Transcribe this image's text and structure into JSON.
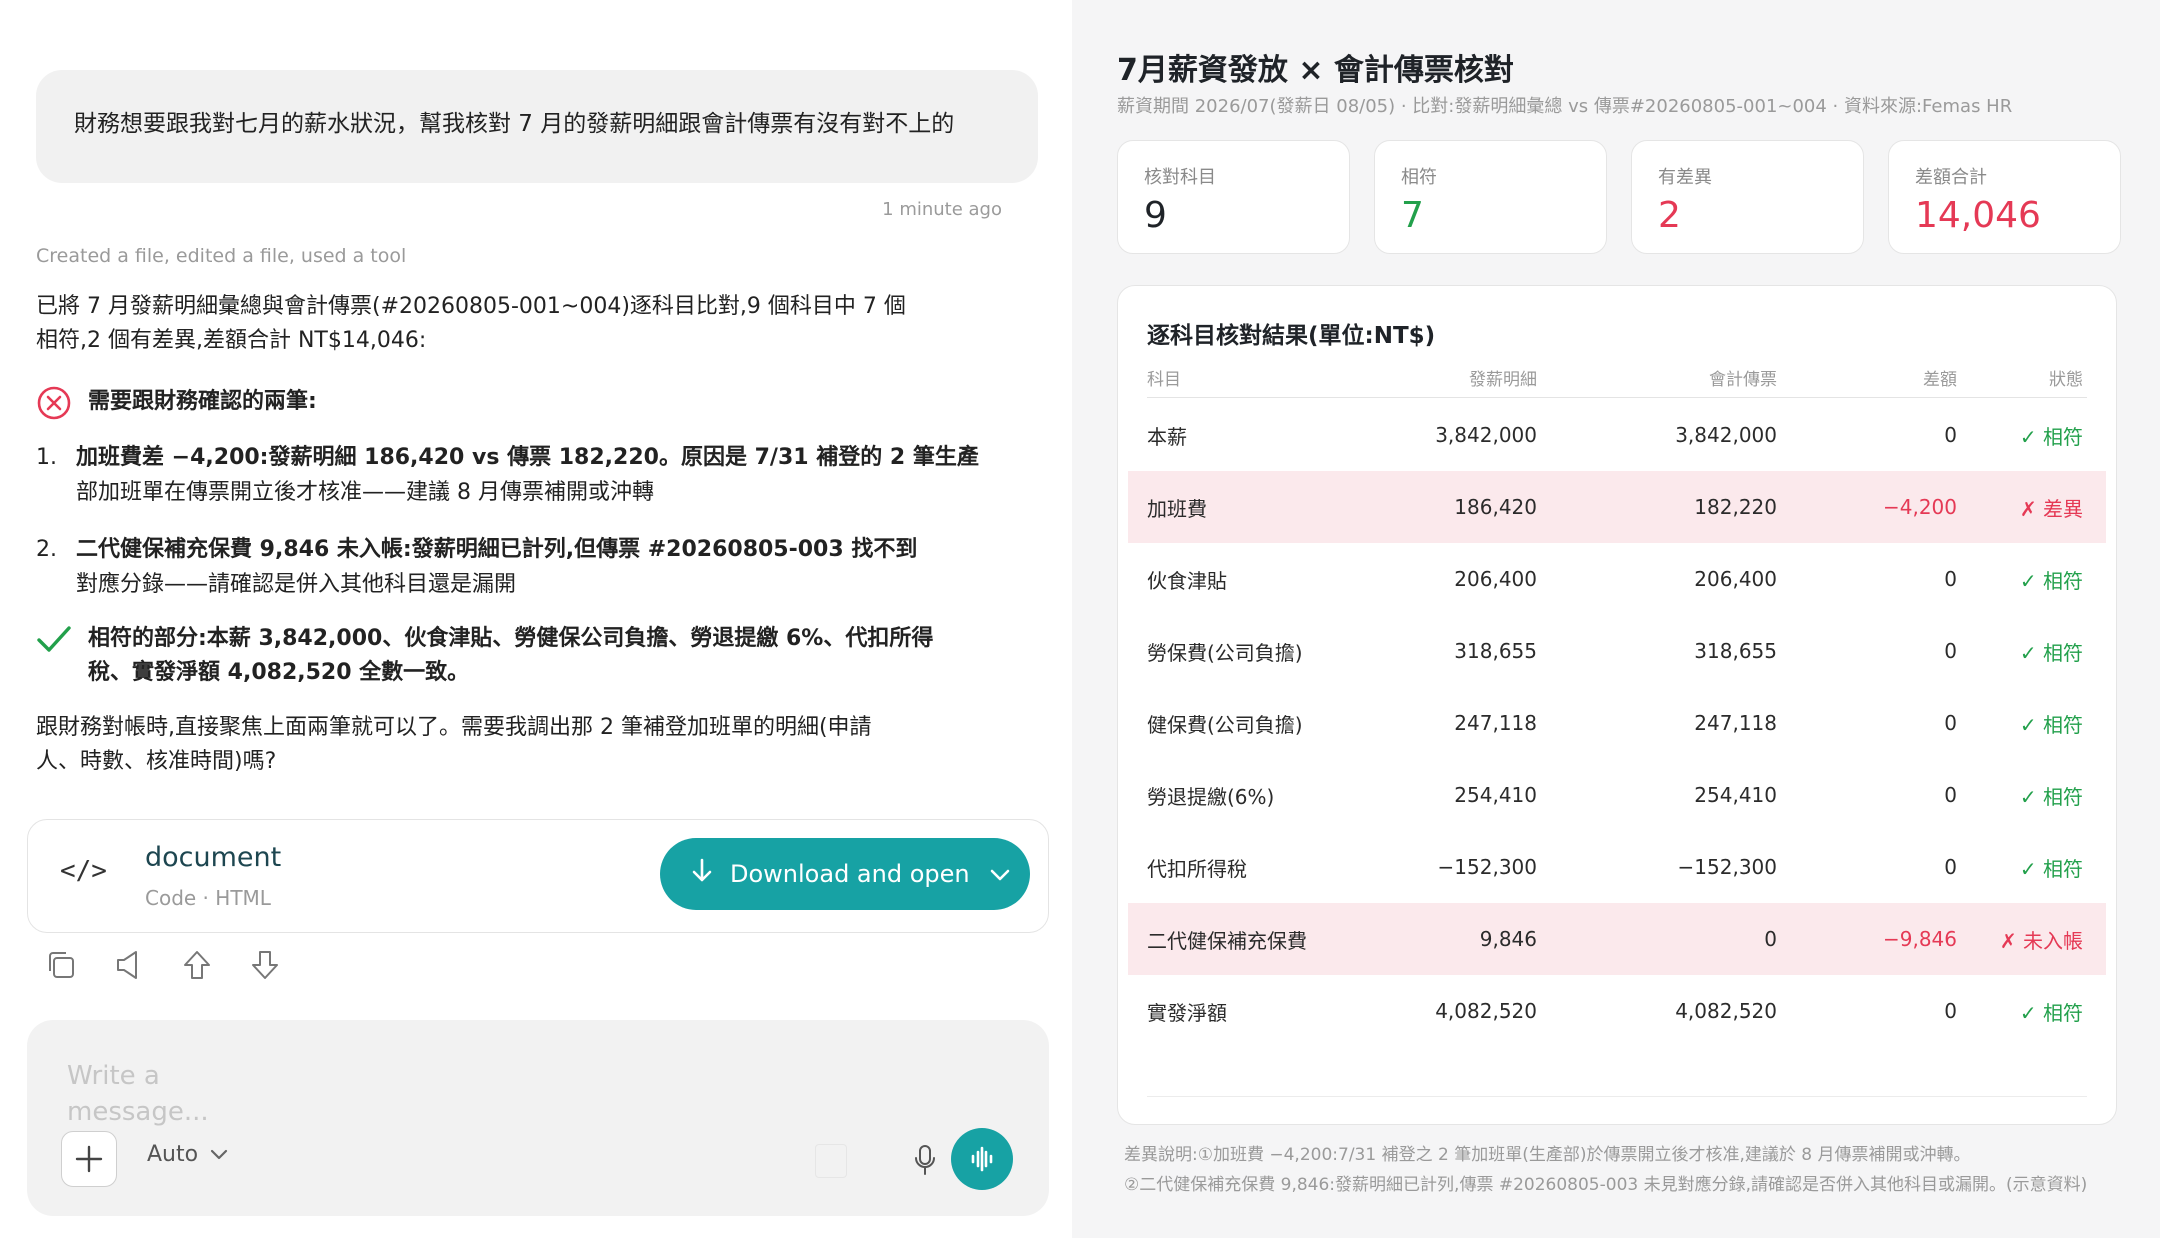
{
  "chat": {
    "user_message": "財務想要跟我對七月的薪水狀況，幫我核對 7 月的發薪明細跟會計傳票有沒有對不上的",
    "timestamp": "1 minute ago",
    "tool_note": "Created a file, edited a file, used a tool",
    "intro_line1": "已將 7 月發薪明細彙總與會計傳票(#20260805-001~004)逐科目比對,9 個科目中 7 個",
    "intro_line2": "相符,2 個有差異,差額合計 NT$14,046:",
    "section_diff_title": "需要跟財務確認的兩筆:",
    "items": [
      {
        "num": "1.",
        "bold": "加班費差 −4,200:發薪明細 186,420 vs 傳票 182,220。原因是 7/31 補登的 2 筆生產",
        "line2": "部加班單在傳票開立後才核准——建議 8 月傳票補開或沖轉"
      },
      {
        "num": "2.",
        "bold": "二代健保補充保費 9,846 未入帳:發薪明細已計列,但傳票 #20260805-003 找不到",
        "line2": "對應分錄——請確認是併入其他科目還是漏開"
      }
    ],
    "section_ok_line1": "相符的部分:本薪 3,842,000、伙食津貼、勞健保公司負擔、勞退提繳 6%、代扣所得",
    "section_ok_line2": "稅、實發淨額 4,082,520 全數一致。",
    "closing_line1": "跟財務對帳時,直接聚焦上面兩筆就可以了。需要我調出那 2 筆補登加班單的明細(申請",
    "closing_line2": "人、時數、核准時間)嗎?",
    "file": {
      "name": "document",
      "meta": "Code · HTML",
      "code_glyph": "</>",
      "download_label": "Download and open"
    },
    "composer": {
      "placeholder": "Write a message...",
      "model": "Auto"
    },
    "icons": [
      "copy-icon",
      "speaker-icon",
      "thumb-up-icon",
      "thumb-down-icon",
      "plus-icon",
      "chevron-down-icon",
      "mic-icon",
      "voice-wave-icon",
      "download-icon",
      "error-circle-icon",
      "check-icon"
    ],
    "colors": {
      "accent": "#17a2a4",
      "error": "#e53955",
      "success": "#22a04b"
    }
  },
  "report": {
    "title": "7月薪資發放 × 會計傳票核對",
    "subtitle": "薪資期間 2026/07(發薪日 08/05) · 比對:發薪明細彙總 vs 傳票#20260805-001~004 · 資料來源:Femas HR",
    "kpis": [
      {
        "label": "核對科目",
        "value": "9",
        "tone": "neutral"
      },
      {
        "label": "相符",
        "value": "7",
        "tone": "green"
      },
      {
        "label": "有差異",
        "value": "2",
        "tone": "red"
      },
      {
        "label": "差額合計",
        "value": "14,046",
        "tone": "red"
      }
    ],
    "table_title": "逐科目核對結果(單位:NT$)",
    "columns": [
      "科目",
      "發薪明細",
      "會計傳票",
      "差額",
      "狀態"
    ],
    "rows": [
      {
        "item": "本薪",
        "payroll": "3,842,000",
        "voucher": "3,842,000",
        "diff": "0",
        "status": "✓ 相符",
        "ok": true
      },
      {
        "item": "加班費",
        "payroll": "186,420",
        "voucher": "182,220",
        "diff": "−4,200",
        "status": "✗ 差異",
        "ok": false
      },
      {
        "item": "伙食津貼",
        "payroll": "206,400",
        "voucher": "206,400",
        "diff": "0",
        "status": "✓ 相符",
        "ok": true
      },
      {
        "item": "勞保費(公司負擔)",
        "payroll": "318,655",
        "voucher": "318,655",
        "diff": "0",
        "status": "✓ 相符",
        "ok": true
      },
      {
        "item": "健保費(公司負擔)",
        "payroll": "247,118",
        "voucher": "247,118",
        "diff": "0",
        "status": "✓ 相符",
        "ok": true
      },
      {
        "item": "勞退提繳(6%)",
        "payroll": "254,410",
        "voucher": "254,410",
        "diff": "0",
        "status": "✓ 相符",
        "ok": true
      },
      {
        "item": "代扣所得稅",
        "payroll": "−152,300",
        "voucher": "−152,300",
        "diff": "0",
        "status": "✓ 相符",
        "ok": true
      },
      {
        "item": "二代健保補充保費",
        "payroll": "9,846",
        "voucher": "0",
        "diff": "−9,846",
        "status": "✗ 未入帳",
        "ok": false
      },
      {
        "item": "實發淨額",
        "payroll": "4,082,520",
        "voucher": "4,082,520",
        "diff": "0",
        "status": "✓ 相符",
        "ok": true
      }
    ],
    "note1": "差異說明:①加班費 −4,200:7/31 補登之 2 筆加班單(生產部)於傳票開立後才核准,建議於 8 月傳票補開或沖轉。",
    "note2": "②二代健保補充保費 9,846:發薪明細已計列,傳票 #20260805-003 未見對應分錄,請確認是否併入其他科目或漏開。(示意資料)"
  }
}
